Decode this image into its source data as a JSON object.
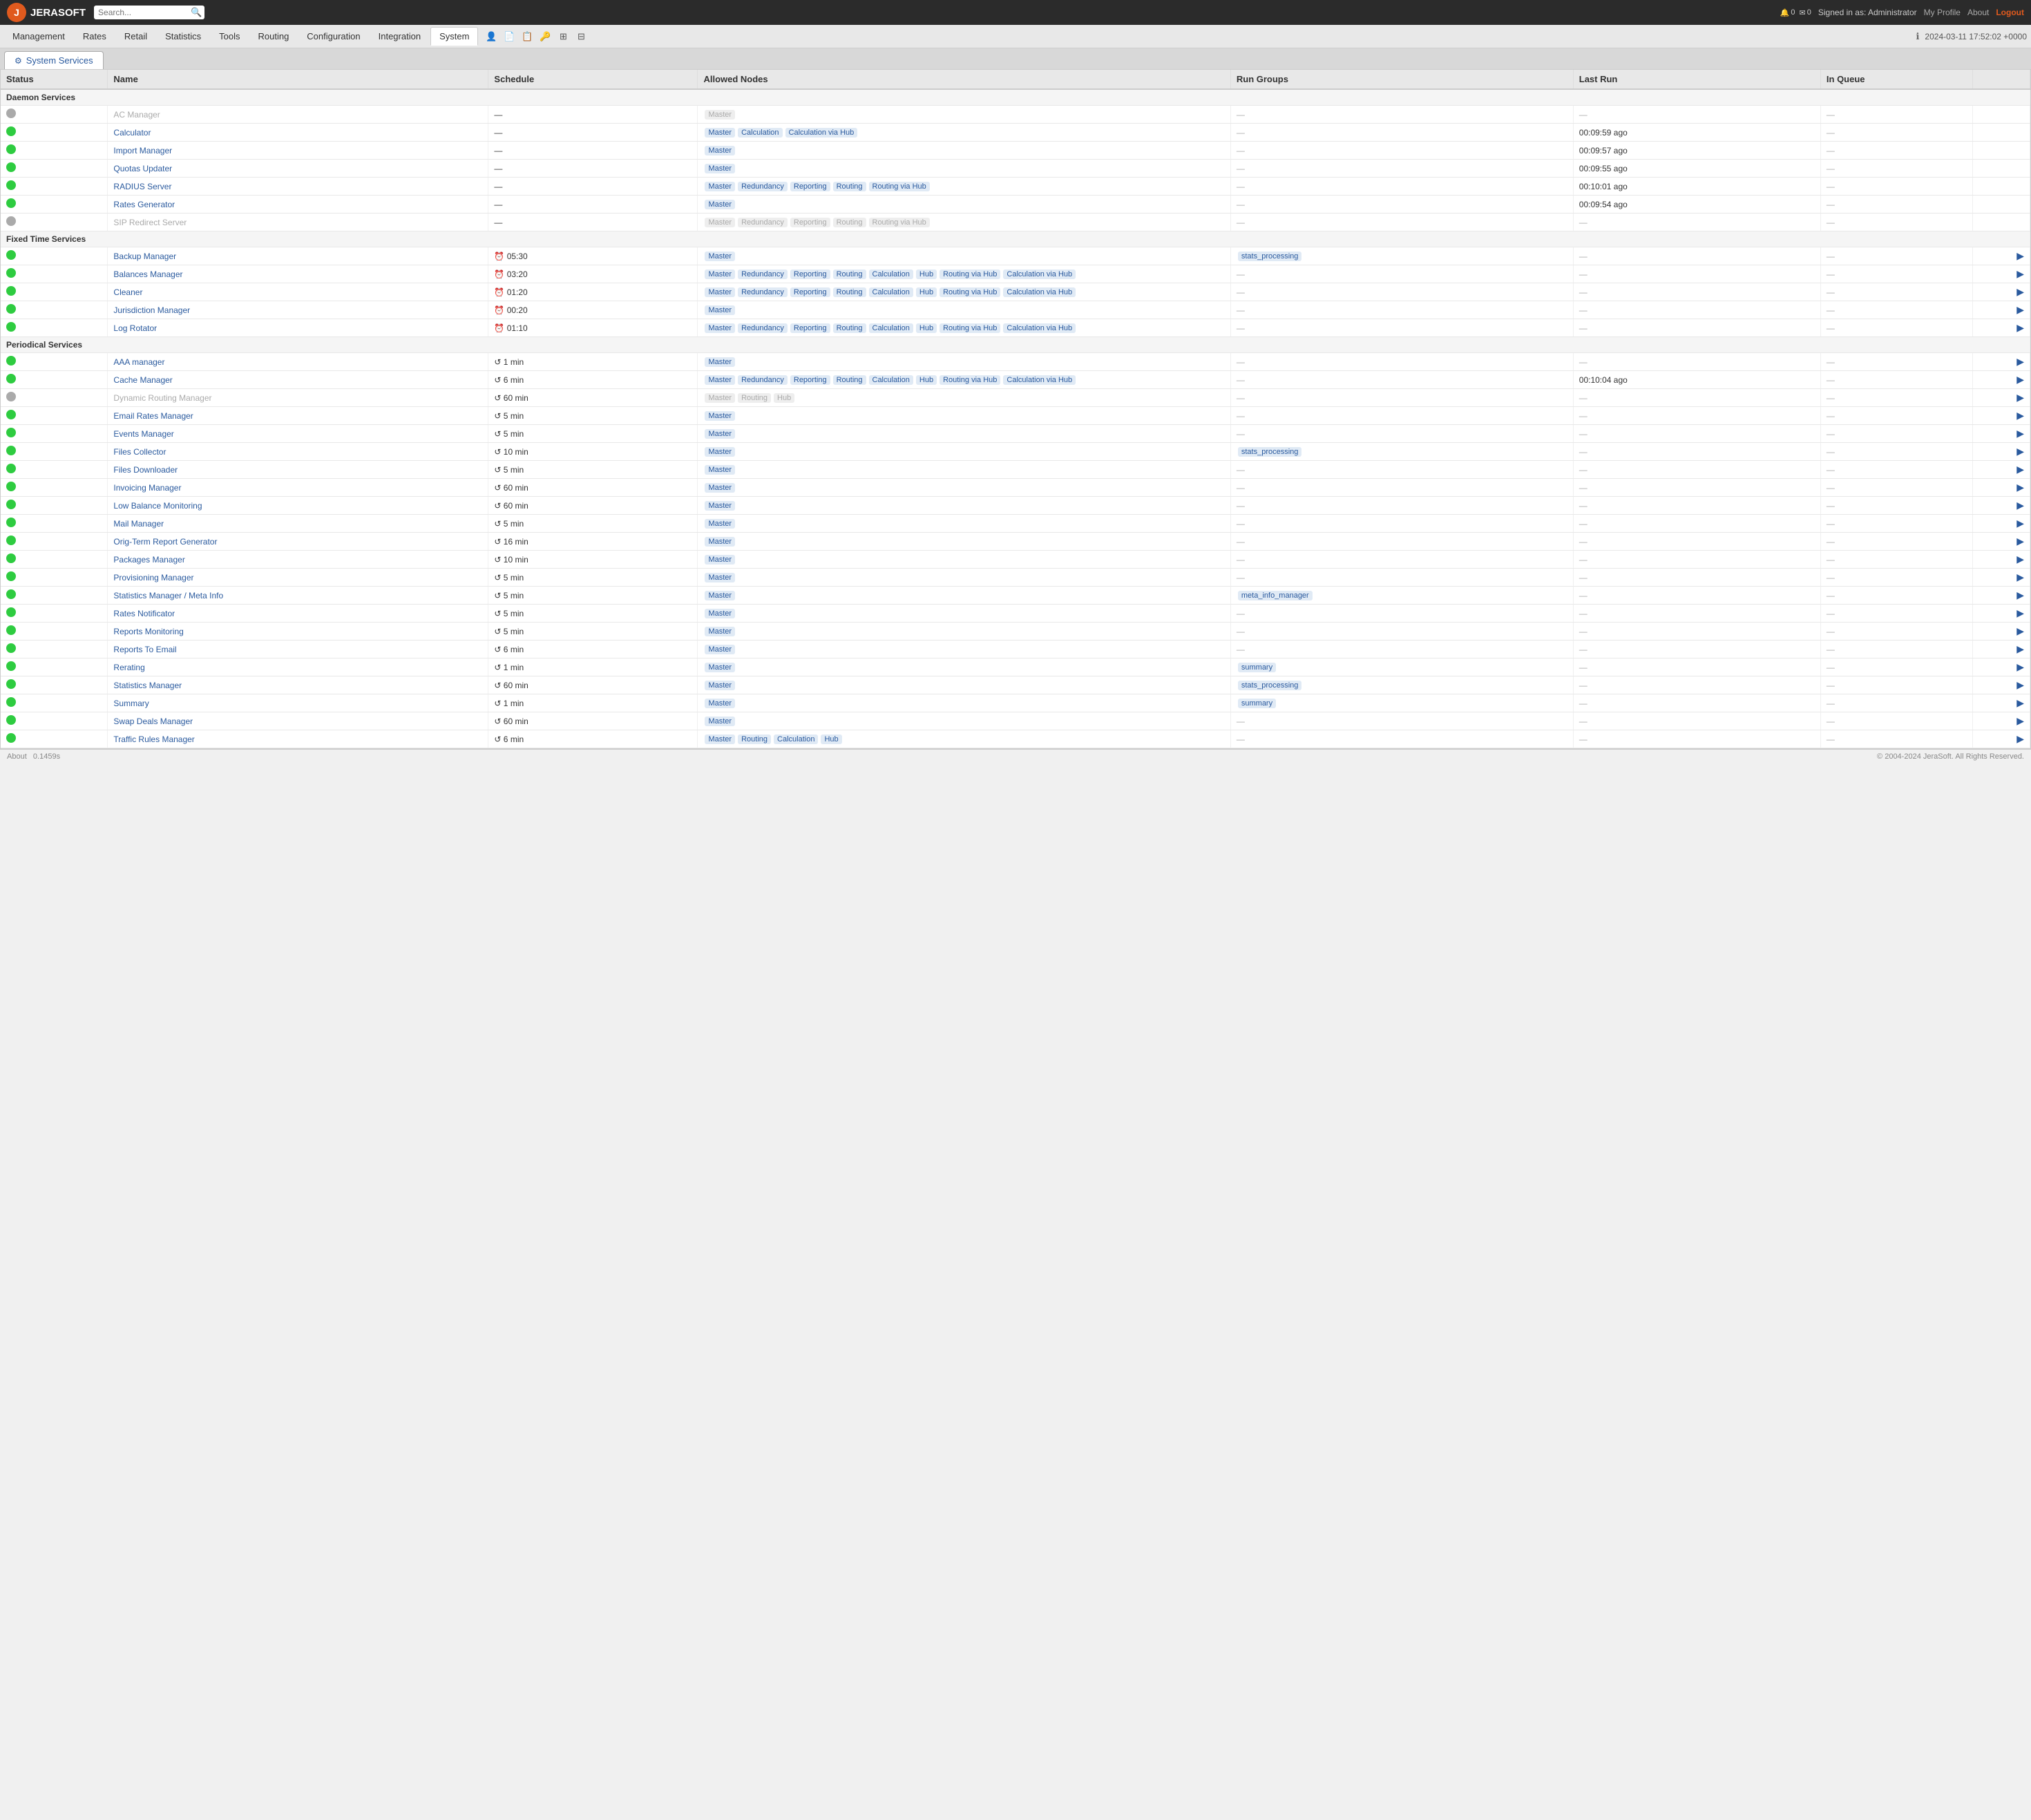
{
  "topbar": {
    "logo_text": "JERASOFT",
    "search_placeholder": "Search...",
    "signed_in": "Signed in as: Administrator",
    "my_profile": "My Profile",
    "about": "About",
    "logout": "Logout",
    "notif1": "0",
    "notif2": "0"
  },
  "nav": {
    "items": [
      {
        "label": "Management",
        "active": false
      },
      {
        "label": "Rates",
        "active": false
      },
      {
        "label": "Retail",
        "active": false
      },
      {
        "label": "Statistics",
        "active": false
      },
      {
        "label": "Tools",
        "active": false
      },
      {
        "label": "Routing",
        "active": false
      },
      {
        "label": "Configuration",
        "active": false
      },
      {
        "label": "Integration",
        "active": false
      },
      {
        "label": "System",
        "active": true
      }
    ],
    "datetime": "2024-03-11 17:52:02 +0000"
  },
  "tab": {
    "label": "System Services",
    "icon": "⚙"
  },
  "table": {
    "headers": [
      "Status",
      "Name",
      "Schedule",
      "Allowed Nodes",
      "Run Groups",
      "Last Run",
      "In Queue"
    ],
    "sections": [
      {
        "title": "Daemon Services",
        "rows": [
          {
            "status": "gray",
            "name": "AC Manager",
            "schedule": "—",
            "nodes": [
              "Master"
            ],
            "nodes_disabled": true,
            "groups": "—",
            "lastrun": "—",
            "inqueue": "—",
            "has_run": false
          },
          {
            "status": "green",
            "name": "Calculator",
            "schedule": "—",
            "nodes": [
              "Master",
              "Calculation",
              "Calculation via Hub"
            ],
            "groups": "—",
            "lastrun": "00:09:59 ago",
            "inqueue": "—",
            "has_run": false
          },
          {
            "status": "green",
            "name": "Import Manager",
            "schedule": "—",
            "nodes": [
              "Master"
            ],
            "groups": "—",
            "lastrun": "00:09:57 ago",
            "inqueue": "—",
            "has_run": false
          },
          {
            "status": "green",
            "name": "Quotas Updater",
            "schedule": "—",
            "nodes": [
              "Master"
            ],
            "groups": "—",
            "lastrun": "00:09:55 ago",
            "inqueue": "—",
            "has_run": false
          },
          {
            "status": "green",
            "name": "RADIUS Server",
            "schedule": "—",
            "nodes": [
              "Master",
              "Redundancy",
              "Reporting",
              "Routing",
              "Routing via Hub"
            ],
            "groups": "—",
            "lastrun": "00:10:01 ago",
            "inqueue": "—",
            "has_run": false
          },
          {
            "status": "green",
            "name": "Rates Generator",
            "schedule": "—",
            "nodes": [
              "Master"
            ],
            "groups": "—",
            "lastrun": "00:09:54 ago",
            "inqueue": "—",
            "has_run": false
          },
          {
            "status": "gray",
            "name": "SIP Redirect Server",
            "schedule": "—",
            "nodes": [
              "Master",
              "Redundancy",
              "Reporting",
              "Routing",
              "Routing via Hub"
            ],
            "nodes_disabled": true,
            "groups": "—",
            "lastrun": "—",
            "inqueue": "—",
            "has_run": false
          }
        ]
      },
      {
        "title": "Fixed Time Services",
        "rows": [
          {
            "status": "green",
            "name": "Backup Manager",
            "schedule": "⏰ 05:30",
            "nodes": [
              "Master"
            ],
            "groups": "stats_processing",
            "lastrun": "—",
            "inqueue": "—",
            "has_run": true
          },
          {
            "status": "green",
            "name": "Balances Manager",
            "schedule": "⏰ 03:20",
            "nodes": [
              "Master",
              "Redundancy",
              "Reporting",
              "Routing",
              "Calculation",
              "Hub",
              "Routing via Hub",
              "Calculation via Hub"
            ],
            "groups": "—",
            "lastrun": "—",
            "inqueue": "—",
            "has_run": true
          },
          {
            "status": "green",
            "name": "Cleaner",
            "schedule": "⏰ 01:20",
            "nodes": [
              "Master",
              "Redundancy",
              "Reporting",
              "Routing",
              "Calculation",
              "Hub",
              "Routing via Hub",
              "Calculation via Hub"
            ],
            "groups": "—",
            "lastrun": "—",
            "inqueue": "—",
            "has_run": true
          },
          {
            "status": "green",
            "name": "Jurisdiction Manager",
            "schedule": "⏰ 00:20",
            "nodes": [
              "Master"
            ],
            "groups": "—",
            "lastrun": "—",
            "inqueue": "—",
            "has_run": true
          },
          {
            "status": "green",
            "name": "Log Rotator",
            "schedule": "⏰ 01:10",
            "nodes": [
              "Master",
              "Redundancy",
              "Reporting",
              "Routing",
              "Calculation",
              "Hub",
              "Routing via Hub",
              "Calculation via Hub"
            ],
            "groups": "—",
            "lastrun": "—",
            "inqueue": "—",
            "has_run": true
          }
        ]
      },
      {
        "title": "Periodical Services",
        "rows": [
          {
            "status": "green",
            "name": "AAA manager",
            "schedule": "↺ 1 min",
            "nodes": [
              "Master"
            ],
            "groups": "—",
            "lastrun": "—",
            "inqueue": "—",
            "has_run": true
          },
          {
            "status": "green",
            "name": "Cache Manager",
            "schedule": "↺ 6 min",
            "nodes": [
              "Master",
              "Redundancy",
              "Reporting",
              "Routing",
              "Calculation",
              "Hub",
              "Routing via Hub",
              "Calculation via Hub"
            ],
            "groups": "—",
            "lastrun": "00:10:04 ago",
            "inqueue": "—",
            "has_run": true
          },
          {
            "status": "gray",
            "name": "Dynamic Routing Manager",
            "schedule": "↺ 60 min",
            "nodes": [
              "Master",
              "Routing",
              "Hub"
            ],
            "nodes_disabled": true,
            "groups": "—",
            "lastrun": "—",
            "inqueue": "—",
            "has_run": true
          },
          {
            "status": "green",
            "name": "Email Rates Manager",
            "schedule": "↺ 5 min",
            "nodes": [
              "Master"
            ],
            "groups": "—",
            "lastrun": "—",
            "inqueue": "—",
            "has_run": true
          },
          {
            "status": "green",
            "name": "Events Manager",
            "schedule": "↺ 5 min",
            "nodes": [
              "Master"
            ],
            "groups": "—",
            "lastrun": "—",
            "inqueue": "—",
            "has_run": true
          },
          {
            "status": "green",
            "name": "Files Collector",
            "schedule": "↺ 10 min",
            "nodes": [
              "Master"
            ],
            "groups": "stats_processing",
            "lastrun": "—",
            "inqueue": "—",
            "has_run": true
          },
          {
            "status": "green",
            "name": "Files Downloader",
            "schedule": "↺ 5 min",
            "nodes": [
              "Master"
            ],
            "groups": "—",
            "lastrun": "—",
            "inqueue": "—",
            "has_run": true
          },
          {
            "status": "green",
            "name": "Invoicing Manager",
            "schedule": "↺ 60 min",
            "nodes": [
              "Master"
            ],
            "groups": "—",
            "lastrun": "—",
            "inqueue": "—",
            "has_run": true
          },
          {
            "status": "green",
            "name": "Low Balance Monitoring",
            "schedule": "↺ 60 min",
            "nodes": [
              "Master"
            ],
            "groups": "—",
            "lastrun": "—",
            "inqueue": "—",
            "has_run": true
          },
          {
            "status": "green",
            "name": "Mail Manager",
            "schedule": "↺ 5 min",
            "nodes": [
              "Master"
            ],
            "groups": "—",
            "lastrun": "—",
            "inqueue": "—",
            "has_run": true
          },
          {
            "status": "green",
            "name": "Orig-Term Report Generator",
            "schedule": "↺ 16 min",
            "nodes": [
              "Master"
            ],
            "groups": "—",
            "lastrun": "—",
            "inqueue": "—",
            "has_run": true
          },
          {
            "status": "green",
            "name": "Packages Manager",
            "schedule": "↺ 10 min",
            "nodes": [
              "Master"
            ],
            "groups": "—",
            "lastrun": "—",
            "inqueue": "—",
            "has_run": true
          },
          {
            "status": "green",
            "name": "Provisioning Manager",
            "schedule": "↺ 5 min",
            "nodes": [
              "Master"
            ],
            "groups": "—",
            "lastrun": "—",
            "inqueue": "—",
            "has_run": true
          },
          {
            "status": "green",
            "name": "Statistics Manager / Meta Info",
            "schedule": "↺ 5 min",
            "nodes": [
              "Master"
            ],
            "groups": "meta_info_manager",
            "lastrun": "—",
            "inqueue": "—",
            "has_run": true
          },
          {
            "status": "green",
            "name": "Rates Notificator",
            "schedule": "↺ 5 min",
            "nodes": [
              "Master"
            ],
            "groups": "—",
            "lastrun": "—",
            "inqueue": "—",
            "has_run": true
          },
          {
            "status": "green",
            "name": "Reports Monitoring",
            "schedule": "↺ 5 min",
            "nodes": [
              "Master"
            ],
            "groups": "—",
            "lastrun": "—",
            "inqueue": "—",
            "has_run": true
          },
          {
            "status": "green",
            "name": "Reports To Email",
            "schedule": "↺ 6 min",
            "nodes": [
              "Master"
            ],
            "groups": "—",
            "lastrun": "—",
            "inqueue": "—",
            "has_run": true
          },
          {
            "status": "green",
            "name": "Rerating",
            "schedule": "↺ 1 min",
            "nodes": [
              "Master"
            ],
            "groups": "summary",
            "lastrun": "—",
            "inqueue": "—",
            "has_run": true
          },
          {
            "status": "green",
            "name": "Statistics Manager",
            "schedule": "↺ 60 min",
            "nodes": [
              "Master"
            ],
            "groups": "stats_processing",
            "lastrun": "—",
            "inqueue": "—",
            "has_run": true
          },
          {
            "status": "green",
            "name": "Summary",
            "schedule": "↺ 1 min",
            "nodes": [
              "Master"
            ],
            "groups": "summary",
            "lastrun": "—",
            "inqueue": "—",
            "has_run": true
          },
          {
            "status": "green",
            "name": "Swap Deals Manager",
            "schedule": "↺ 60 min",
            "nodes": [
              "Master"
            ],
            "groups": "—",
            "lastrun": "—",
            "inqueue": "—",
            "has_run": true
          },
          {
            "status": "green",
            "name": "Traffic Rules Manager",
            "schedule": "↺ 6 min",
            "nodes": [
              "Master",
              "Routing",
              "Calculation",
              "Hub"
            ],
            "groups": "—",
            "lastrun": "—",
            "inqueue": "—",
            "has_run": true
          }
        ]
      }
    ]
  },
  "footer": {
    "about": "About",
    "version": "0.1459s",
    "copyright": "© 2004-2024 JeraSoft. All Rights Reserved."
  }
}
